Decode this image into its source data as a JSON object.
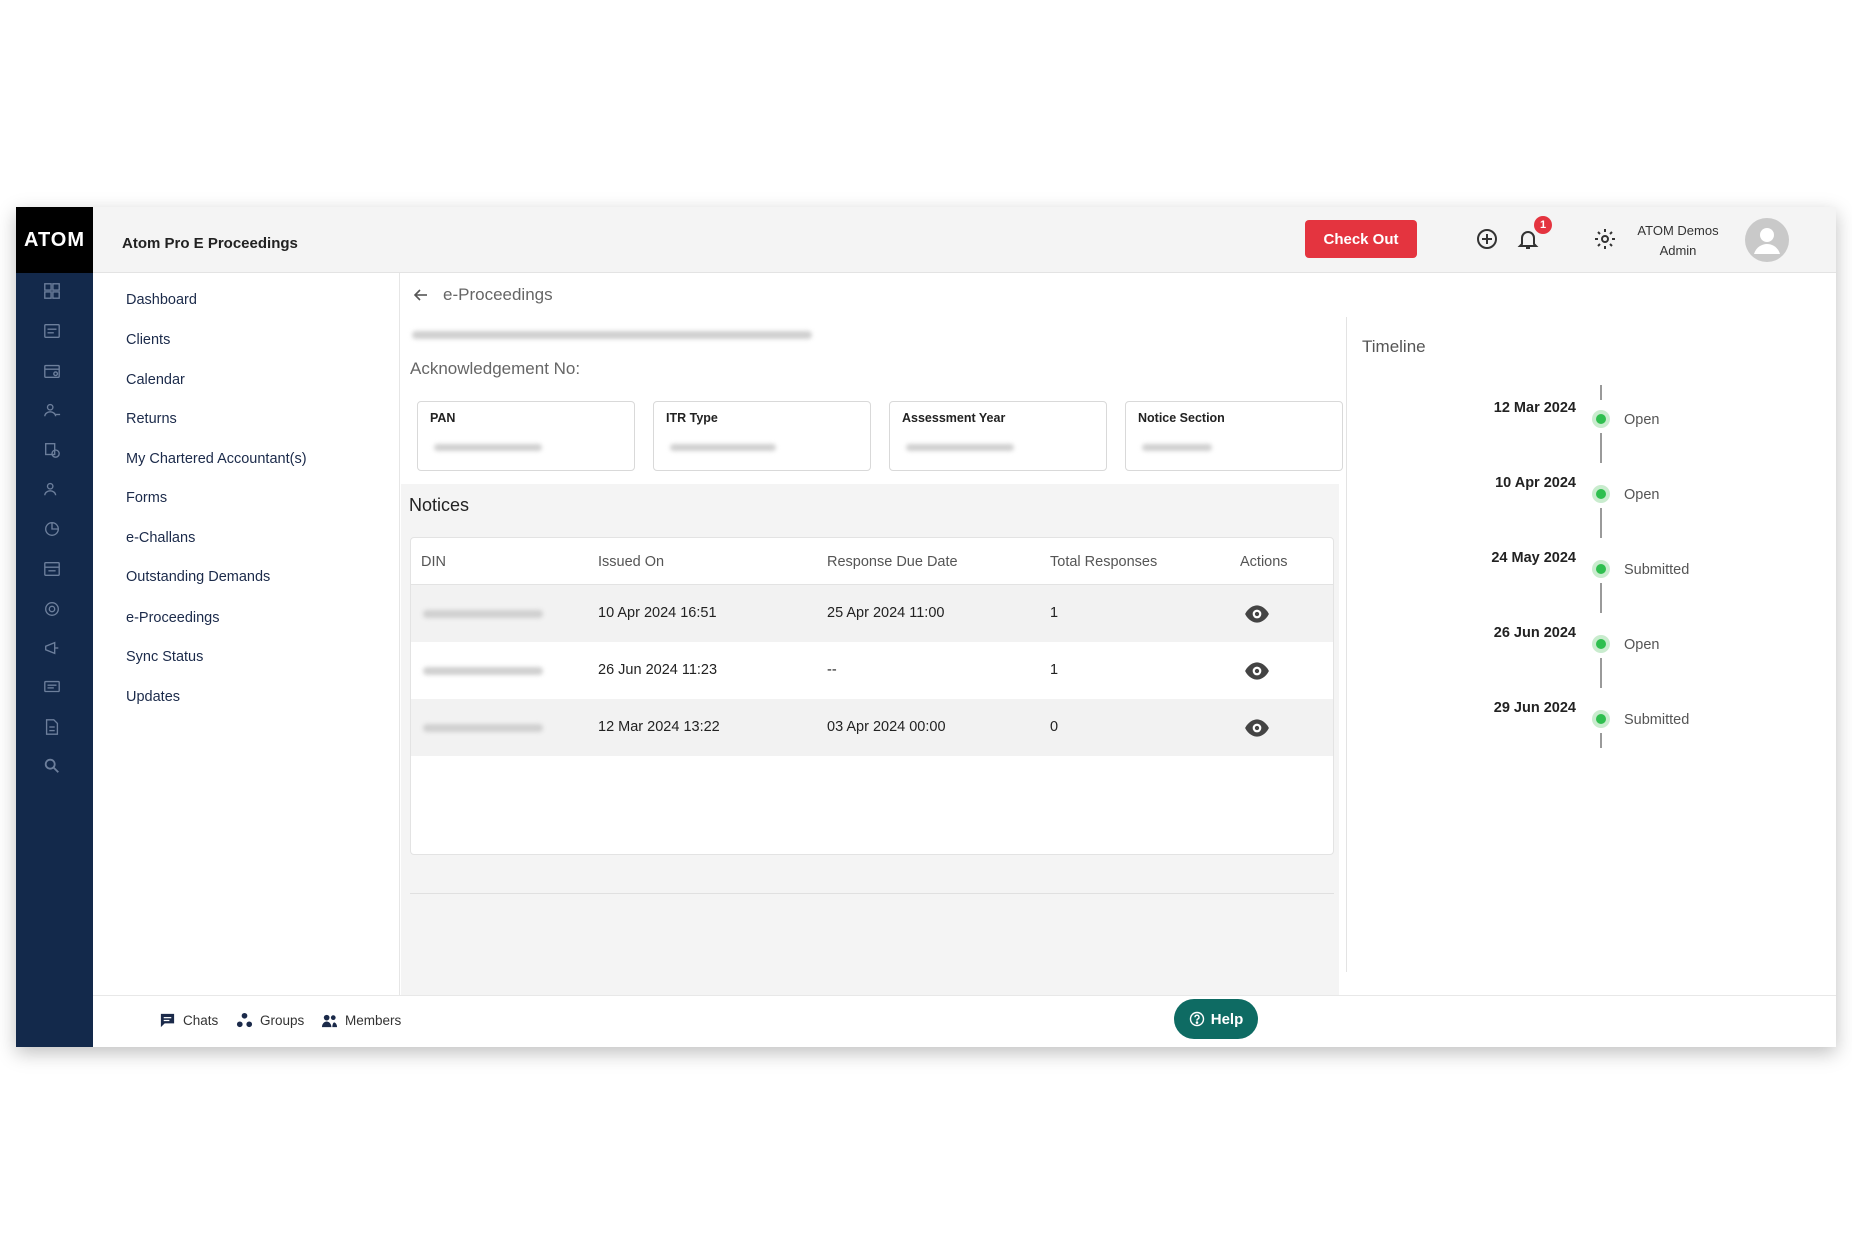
{
  "app": {
    "logo": "ATOM",
    "title": "Atom Pro E Proceedings"
  },
  "header": {
    "checkout_label": "Check Out",
    "notification_count": "1",
    "user_name": "ATOM Demos",
    "user_role": "Admin"
  },
  "sidebar": {
    "items": [
      {
        "label": "Dashboard"
      },
      {
        "label": "Clients"
      },
      {
        "label": "Calendar"
      },
      {
        "label": "Returns"
      },
      {
        "label": "My Chartered Accountant(s)"
      },
      {
        "label": "Forms"
      },
      {
        "label": "e-Challans"
      },
      {
        "label": "Outstanding Demands"
      },
      {
        "label": "e-Proceedings"
      },
      {
        "label": "Sync Status"
      },
      {
        "label": "Updates"
      }
    ]
  },
  "main": {
    "breadcrumb": "e-Proceedings",
    "acknowledgement_label": "Acknowledgement No:",
    "info_cards": [
      {
        "label": "PAN"
      },
      {
        "label": "ITR Type"
      },
      {
        "label": "Assessment Year"
      },
      {
        "label": "Notice Section"
      }
    ],
    "notices_title": "Notices",
    "table": {
      "columns": [
        "DIN",
        "Issued On",
        "Response Due Date",
        "Total Responses",
        "Actions"
      ],
      "rows": [
        {
          "issued_on": "10 Apr 2024 16:51",
          "due_date": "25 Apr 2024 11:00",
          "responses": "1"
        },
        {
          "issued_on": "26 Jun 2024 11:23",
          "due_date": "--",
          "responses": "1"
        },
        {
          "issued_on": "12 Mar 2024 13:22",
          "due_date": "03 Apr 2024 00:00",
          "responses": "0"
        }
      ]
    }
  },
  "timeline": {
    "title": "Timeline",
    "events": [
      {
        "date": "12 Mar 2024",
        "status": "Open"
      },
      {
        "date": "10 Apr 2024",
        "status": "Open"
      },
      {
        "date": "24 May 2024",
        "status": "Submitted"
      },
      {
        "date": "26 Jun 2024",
        "status": "Open"
      },
      {
        "date": "29 Jun 2024",
        "status": "Submitted"
      }
    ]
  },
  "footer": {
    "chats_label": "Chats",
    "groups_label": "Groups",
    "members_label": "Members",
    "help_label": "Help"
  },
  "colors": {
    "rail": "#13294b",
    "accent_red": "#e4343f",
    "help_teal": "#0e6b63",
    "timeline_green": "#2fbf4f"
  },
  "icons": [
    "dashboard-icon",
    "clients-icon",
    "calendar-icon",
    "returns-icon",
    "accountant-icon",
    "forms-icon",
    "challan-icon",
    "demands-icon",
    "proceedings-icon",
    "sync-icon",
    "updates-icon",
    "document-icon",
    "search-icon",
    "add-icon",
    "bell-icon",
    "gear-icon",
    "user-icon",
    "eye-icon",
    "back-arrow-icon",
    "chat-icon",
    "groups-icon",
    "members-icon",
    "help-icon"
  ]
}
